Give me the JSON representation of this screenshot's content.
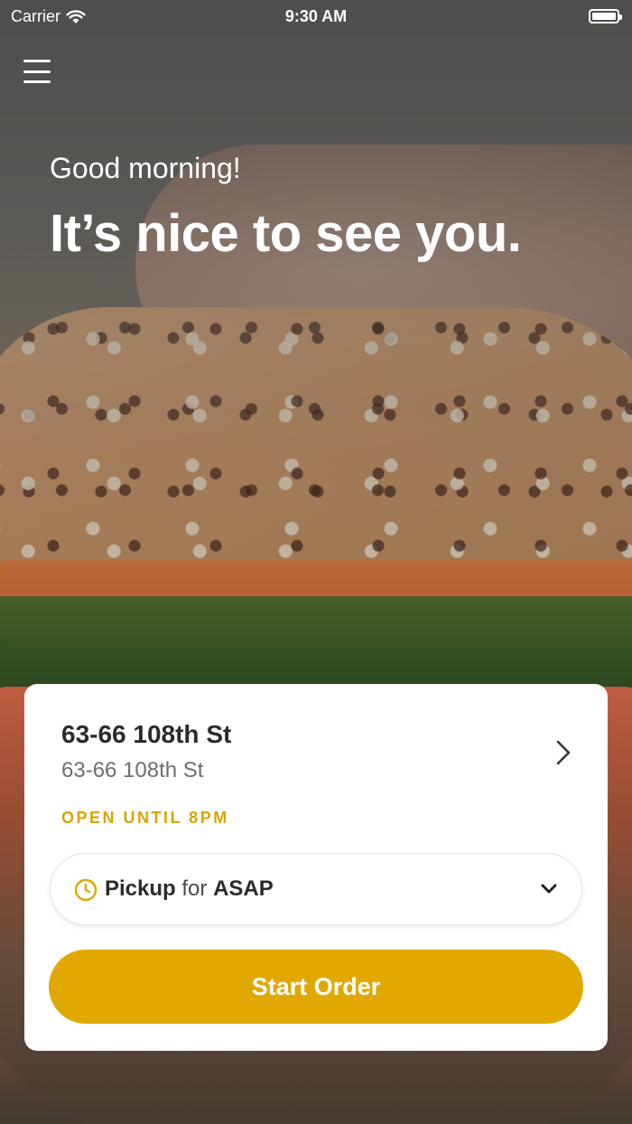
{
  "status_bar": {
    "carrier": "Carrier",
    "time": "9:30 AM"
  },
  "header": {
    "greeting": "Good morning!",
    "headline": "It’s nice to see you."
  },
  "store": {
    "name": "63-66 108th St",
    "address": "63-66 108th St",
    "hours": "OPEN UNTIL 8PM"
  },
  "order_type": {
    "mode": "Pickup",
    "connector": "for",
    "time": "ASAP"
  },
  "start_order_label": "Start Order",
  "colors": {
    "accent": "#e0a800",
    "hours_text": "#d9a300"
  },
  "icons": {
    "menu": "hamburger-menu-icon",
    "store_chevron": "chevron-right-icon",
    "clock": "clock-icon",
    "dropdown": "chevron-down-icon"
  }
}
